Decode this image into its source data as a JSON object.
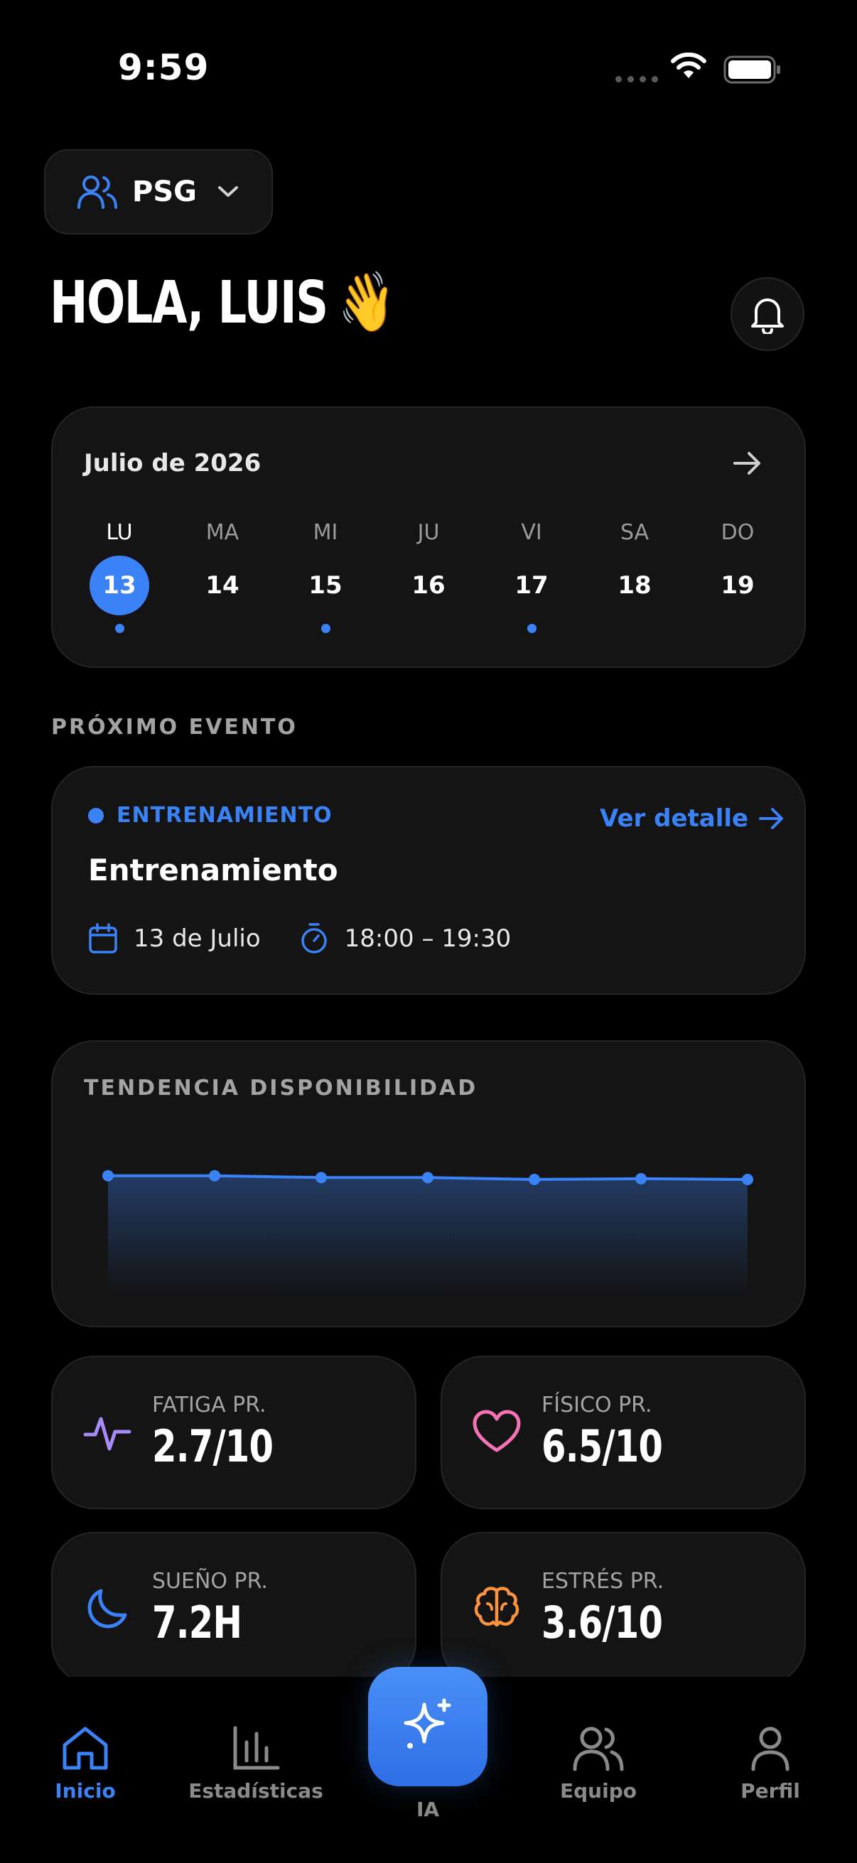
{
  "status_bar": {
    "time": "9:59"
  },
  "team_selector": {
    "name": "PSG"
  },
  "greeting": {
    "text": "HOLA, LUIS",
    "emoji": "👋"
  },
  "calendar": {
    "month_label": "Julio de 2026",
    "days": [
      {
        "label": "LU",
        "number": "13",
        "selected": true,
        "has_event": true
      },
      {
        "label": "MA",
        "number": "14",
        "selected": false,
        "has_event": false
      },
      {
        "label": "MI",
        "number": "15",
        "selected": false,
        "has_event": true
      },
      {
        "label": "JU",
        "number": "16",
        "selected": false,
        "has_event": false
      },
      {
        "label": "VI",
        "number": "17",
        "selected": false,
        "has_event": true
      },
      {
        "label": "SA",
        "number": "18",
        "selected": false,
        "has_event": false
      },
      {
        "label": "DO",
        "number": "19",
        "selected": false,
        "has_event": false
      }
    ]
  },
  "next_event": {
    "section_label": "PRÓXIMO EVENTO",
    "tag": "ENTRENAMIENTO",
    "detail_link": "Ver detalle",
    "title": "Entrenamiento",
    "date": "13 de Julio",
    "time_range": "18:00 – 19:30"
  },
  "trend": {
    "title": "TENDENCIA DISPONIBILIDAD"
  },
  "chart_data": {
    "type": "area",
    "title": "TENDENCIA DISPONIBILIDAD",
    "x": [
      1,
      2,
      3,
      4,
      5,
      6,
      7
    ],
    "values": [
      8.1,
      8.1,
      8.05,
      8.05,
      8.0,
      8.02,
      8.0
    ],
    "ylim": [
      0,
      10
    ],
    "grid": false,
    "color": "#3b82f6"
  },
  "metrics": [
    {
      "label": "FATIGA PR.",
      "value": "2.7/10",
      "icon": "activity-icon",
      "color": "#a78bfa"
    },
    {
      "label": "FÍSICO PR.",
      "value": "6.5/10",
      "icon": "heart-icon",
      "color": "#f472b6"
    },
    {
      "label": "SUEÑO PR.",
      "value": "7.2H",
      "icon": "moon-icon",
      "color": "#3b82f6"
    },
    {
      "label": "ESTRÉS PR.",
      "value": "3.6/10",
      "icon": "brain-icon",
      "color": "#fb923c"
    }
  ],
  "tab_bar": {
    "items": [
      {
        "label": "Inicio",
        "active": true
      },
      {
        "label": "Estadísticas",
        "active": false
      },
      {
        "label": "IA",
        "active": false
      },
      {
        "label": "Equipo",
        "active": false
      },
      {
        "label": "Perfil",
        "active": false
      }
    ]
  },
  "colors": {
    "accent": "#3b82f6",
    "card": "#141414",
    "background": "#000000"
  }
}
